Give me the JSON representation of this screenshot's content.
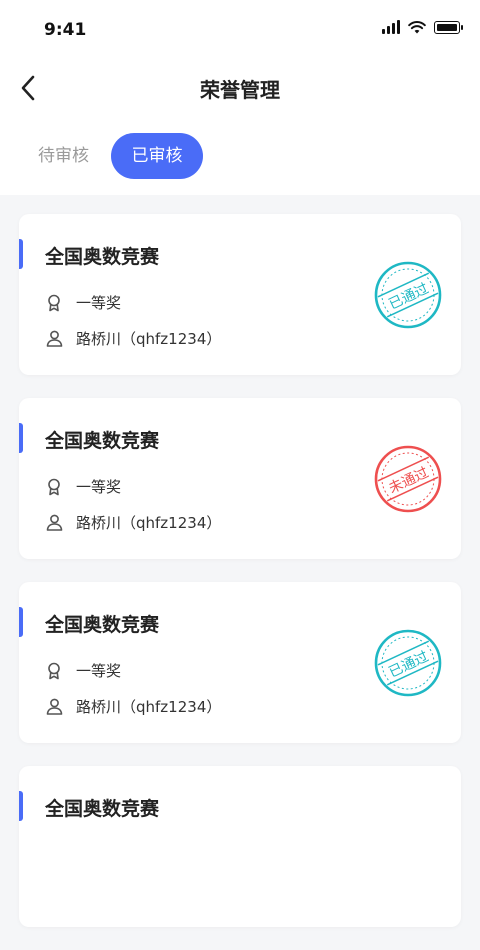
{
  "status_bar": {
    "time": "9:41"
  },
  "header": {
    "title": "荣誉管理"
  },
  "tabs": [
    {
      "label": "待审核",
      "active": false
    },
    {
      "label": "已审核",
      "active": true
    }
  ],
  "colors": {
    "accent": "#4a6cf7",
    "approved": "#1fb8c4",
    "rejected": "#ee4f4f"
  },
  "records": [
    {
      "title": "全国奥数竞赛",
      "award": "一等奖",
      "person": "路桥川（qhfz1234）",
      "status": "已通过"
    },
    {
      "title": "全国奥数竞赛",
      "award": "一等奖",
      "person": "路桥川（qhfz1234）",
      "status": "未通过"
    },
    {
      "title": "全国奥数竞赛",
      "award": "一等奖",
      "person": "路桥川（qhfz1234）",
      "status": "已通过"
    },
    {
      "title": "全国奥数竞赛",
      "award": "",
      "person": "",
      "status": ""
    }
  ]
}
